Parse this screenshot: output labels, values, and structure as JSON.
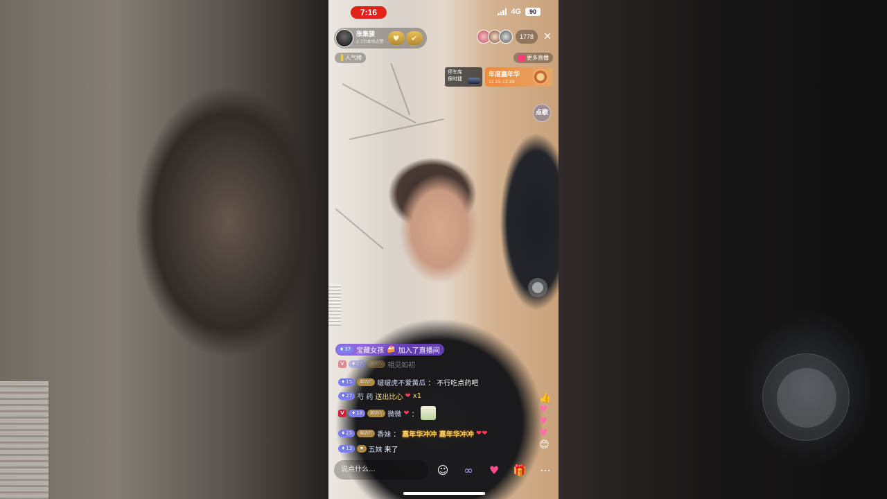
{
  "status_bar": {
    "time": "7:16",
    "network": "4G",
    "battery": "90"
  },
  "host": {
    "name": "张集骏",
    "likes": "2.7万本场点赞"
  },
  "viewers": {
    "count": "1778"
  },
  "rank": {
    "label": "人气榜"
  },
  "more_live": {
    "label": "更多直播"
  },
  "garage": {
    "title": "停车库",
    "brand": "保时捷"
  },
  "carnival": {
    "title": "年度嘉年华",
    "date": "12.25–12.29"
  },
  "song_button": {
    "label": "点歌"
  },
  "chat": {
    "join": {
      "level": "37",
      "user": "宝藏女孩",
      "text": "加入了直播间"
    },
    "messages": [
      {
        "level": "27",
        "fan": "酸奶吖",
        "user": "相见如初",
        "text": "",
        "faded": true
      },
      {
        "level": "15",
        "fan": "酸奶吖",
        "user": "啵啵虎不爱黄瓜",
        "text": "不行吃点药吧"
      },
      {
        "level": "27",
        "user": "芍 药",
        "text": "送出比心",
        "gift_count": "x1"
      },
      {
        "level": "18",
        "fan": "酸奶吖",
        "user": "微微",
        "text": ""
      },
      {
        "level": "25",
        "fan": "酸奶吖",
        "user": "香妹",
        "text": "嘉年华冲冲 嘉年华冲冲"
      },
      {
        "level": "13",
        "user": "五妹",
        "text": "来了"
      }
    ]
  },
  "input": {
    "placeholder": "说点什么..."
  },
  "icons": [
    "emoji-icon",
    "link-icon",
    "heart-icon",
    "gift-icon",
    "more-icon"
  ],
  "colors": {
    "time_pill": "#e2231a",
    "join_bg": "#7846dc",
    "accent_gold": "#e8c15a"
  }
}
